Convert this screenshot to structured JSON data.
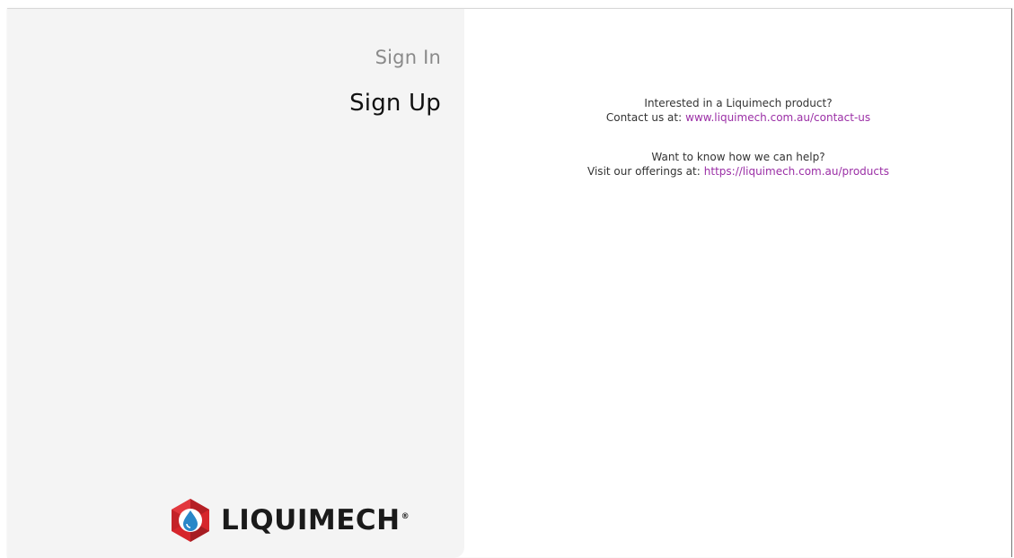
{
  "nav": {
    "sign_in": "Sign In",
    "sign_up": "Sign Up"
  },
  "brand": {
    "name": "LIQUIMECH",
    "registered": "®",
    "logo_icon": "liquimech-hexagon-drop-icon",
    "colors": {
      "red": "#d6262c",
      "dark_red": "#9e1b20",
      "blue": "#2a87c8",
      "text": "#1a1a1a"
    }
  },
  "info": {
    "contact_question": "Interested in a Liquimech product?",
    "contact_prefix": "Contact us at:",
    "contact_link": "www.liquimech.com.au/contact-us",
    "help_question": "Want to know how we can help?",
    "help_prefix": "Visit our offerings at:",
    "help_link": "https://liquimech.com.au/products"
  },
  "colors": {
    "left_panel_bg": "#f4f4f4",
    "link": "#9b2fa6",
    "inactive_nav": "#8a8a8a",
    "active_nav": "#111111"
  }
}
